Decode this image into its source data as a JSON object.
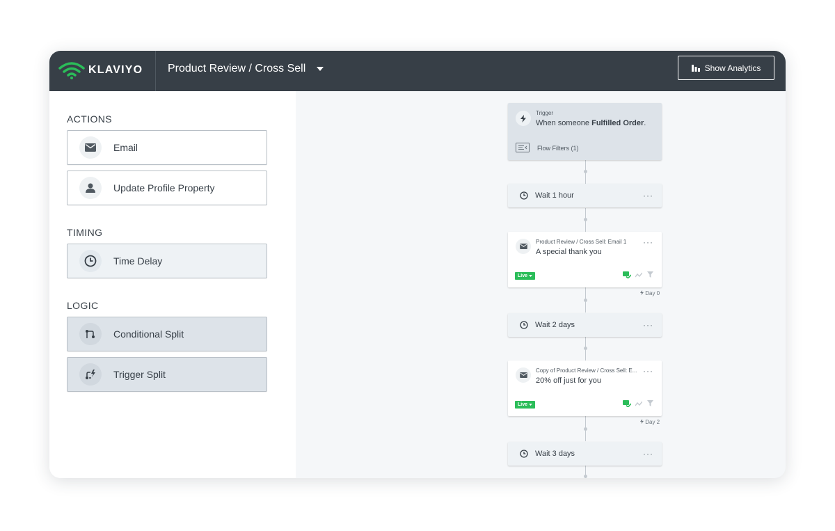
{
  "header": {
    "brand": "KLAVIYO",
    "flow_title": "Product Review / Cross Sell",
    "analytics_button": "Show Analytics"
  },
  "sidebar": {
    "actions_title": "ACTIONS",
    "actions": [
      {
        "label": "Email",
        "icon": "envelope-icon"
      },
      {
        "label": "Update Profile Property",
        "icon": "person-icon"
      }
    ],
    "timing_title": "TIMING",
    "timing": [
      {
        "label": "Time Delay",
        "icon": "clock-icon"
      }
    ],
    "logic_title": "LOGIC",
    "logic": [
      {
        "label": "Conditional Split",
        "icon": "split-icon"
      },
      {
        "label": "Trigger Split",
        "icon": "trigger-split-icon"
      }
    ]
  },
  "flow": {
    "trigger": {
      "label": "Trigger",
      "text_prefix": "When someone ",
      "text_bold": "Fulfilled Order",
      "text_suffix": ".",
      "filters": "Flow Filters (1)"
    },
    "wait1": "Wait 1 hour",
    "email1": {
      "name": "Product Review / Cross Sell: Email 1",
      "subject": "A special thank you",
      "status": "Live",
      "day": "Day 0"
    },
    "wait2": "Wait 2 days",
    "email2": {
      "name": "Copy of Product Review / Cross Sell: E...",
      "subject": "20% off just for you",
      "status": "Live",
      "day": "Day 2"
    },
    "wait3": "Wait 3 days",
    "menu": "···"
  },
  "colors": {
    "header_bg": "#373f47",
    "brand_green": "#2bbd59",
    "live_green": "#2bbd59"
  }
}
